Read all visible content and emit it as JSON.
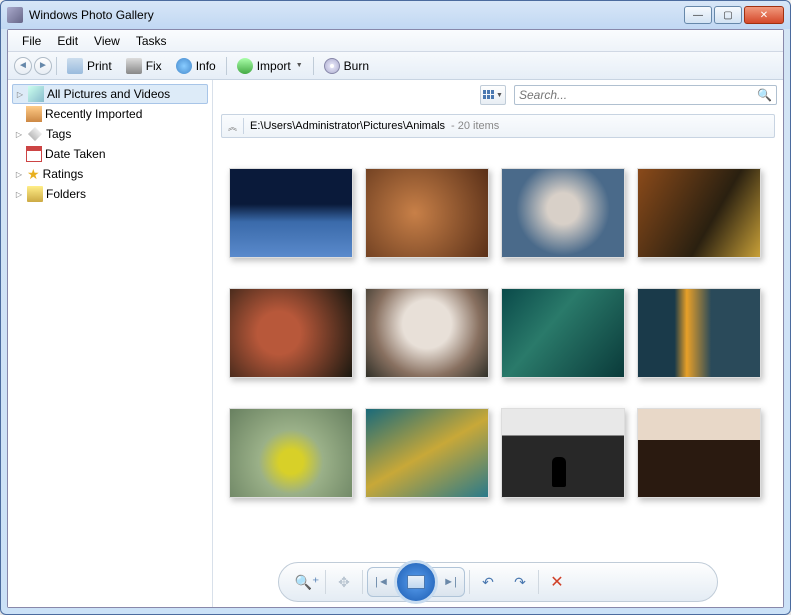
{
  "window": {
    "title": "Windows Photo Gallery"
  },
  "menubar": {
    "file": "File",
    "edit": "Edit",
    "view": "View",
    "tasks": "Tasks"
  },
  "toolbar": {
    "print": "Print",
    "fix": "Fix",
    "info": "Info",
    "import": "Import",
    "burn": "Burn"
  },
  "sidebar": {
    "all": "All Pictures and Videos",
    "recent": "Recently Imported",
    "tags": "Tags",
    "date": "Date Taken",
    "ratings": "Ratings",
    "folders": "Folders"
  },
  "search": {
    "placeholder": "Search..."
  },
  "pathbar": {
    "path": "E:\\Users\\Administrator\\Pictures\\Animals",
    "count": "- 20 items"
  },
  "thumbs": {
    "count": 12
  },
  "viewer": {
    "zoom_tip": "Zoom",
    "fit_tip": "Actual Size",
    "prev_tip": "Previous",
    "play_tip": "Play Slide Show",
    "next_tip": "Next",
    "rotate_ccw_tip": "Rotate Counterclockwise",
    "rotate_cw_tip": "Rotate Clockwise",
    "delete_tip": "Delete"
  }
}
